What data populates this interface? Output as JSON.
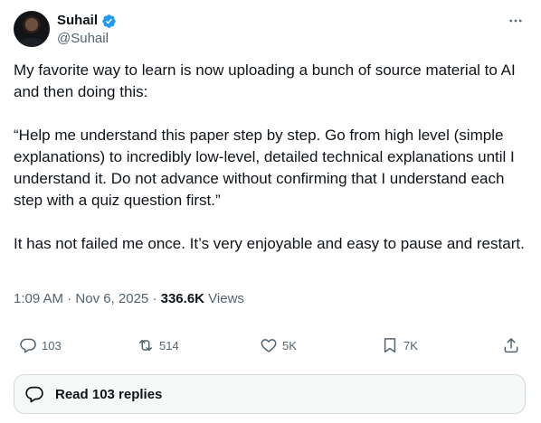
{
  "author": {
    "name": "Suhail",
    "handle": "@Suhail",
    "verified": true
  },
  "tweet": {
    "text": "My favorite way to learn is now uploading a bunch of source material to AI and then doing this:\n\n“Help me understand this paper step by step. Go from high level (simple explanations) to incredibly low-level, detailed technical explanations until I understand it. Do not advance without confirming that I understand each step with a quiz question first.”\n\nIt has not failed me once. It’s very enjoyable and easy to pause and restart.",
    "time": "1:09 AM",
    "date": "Nov 6, 2025",
    "separator": "·",
    "views_count": "336.6K",
    "views_label": "Views"
  },
  "actions": {
    "reply_count": "103",
    "repost_count": "514",
    "like_count": "5K",
    "bookmark_count": "7K"
  },
  "replies_button": {
    "label": "Read 103 replies"
  },
  "colors": {
    "text": "#0f1419",
    "secondary": "#536471",
    "verified_blue": "#1d9bf0",
    "border": "#cfd9de"
  },
  "icons": {
    "verified": "verified-badge-icon",
    "more": "more-dots-icon",
    "reply": "speech-bubble-icon",
    "repost": "repost-arrows-icon",
    "like": "heart-icon",
    "bookmark": "bookmark-icon",
    "share": "share-upload-icon",
    "replies": "speech-bubble-icon"
  }
}
